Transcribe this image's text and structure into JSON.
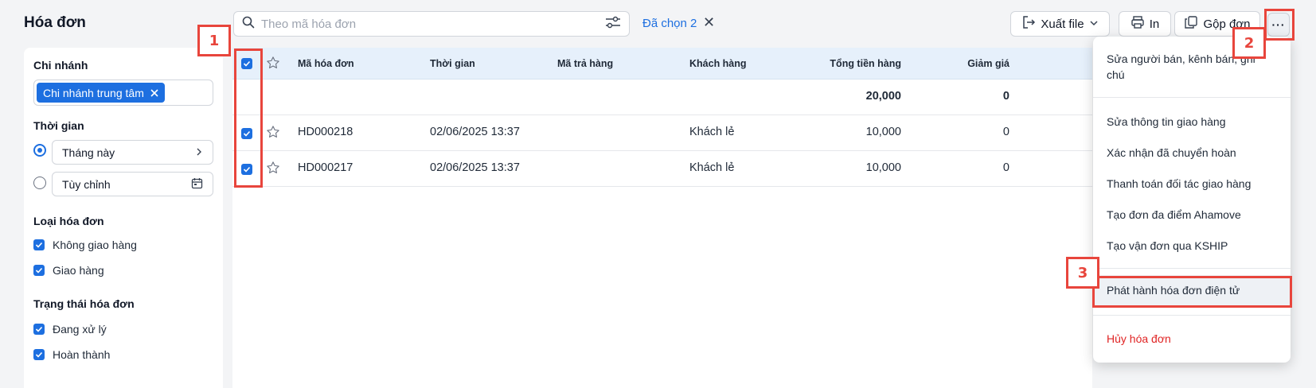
{
  "page": {
    "title": "Hóa đơn"
  },
  "search": {
    "placeholder": "Theo mã hóa đơn"
  },
  "selection": {
    "label": "Đã chọn 2"
  },
  "toolbar": {
    "export_label": "Xuất file",
    "print_label": "In",
    "merge_label": "Gộp đơn",
    "more_label": "···"
  },
  "sidebar": {
    "branch": {
      "heading": "Chi nhánh",
      "tag": "Chi nhánh trung tâm"
    },
    "time": {
      "heading": "Thời gian",
      "option_month": "Tháng này",
      "option_custom": "Tùy chỉnh"
    },
    "invoice_type": {
      "heading": "Loại hóa đơn",
      "items": [
        "Không giao hàng",
        "Giao hàng"
      ]
    },
    "invoice_status": {
      "heading": "Trạng thái hóa đơn",
      "items": [
        "Đang xử lý",
        "Hoàn thành"
      ]
    }
  },
  "table": {
    "headers": [
      "Mã hóa đơn",
      "Thời gian",
      "Mã trả hàng",
      "Khách hàng",
      "Tổng tiền hàng",
      "Giảm giá"
    ],
    "summary": {
      "total": "20,000",
      "discount": "0"
    },
    "rows": [
      {
        "code": "HD000218",
        "time": "02/06/2025 13:37",
        "return_code": "",
        "customer": "Khách lẻ",
        "total": "10,000",
        "discount": "0"
      },
      {
        "code": "HD000217",
        "time": "02/06/2025 13:37",
        "return_code": "",
        "customer": "Khách lẻ",
        "total": "10,000",
        "discount": "0"
      }
    ]
  },
  "menu": {
    "items": [
      "Sửa người bán, kênh bán, ghi chú",
      "Sửa thông tin giao hàng",
      "Xác nhận đã chuyển hoàn",
      "Thanh toán đối tác giao hàng",
      "Tạo đơn đa điểm Ahamove",
      "Tạo vận đơn qua KSHIP",
      "Phát hành hóa đơn điện tử",
      "Hủy hóa đơn"
    ]
  },
  "annotations": [
    "1",
    "2",
    "3"
  ],
  "colors": {
    "accent": "#1d6fe0",
    "annotation": "#e8453c",
    "danger": "#e02424",
    "header_bg": "#e6f0fb"
  }
}
